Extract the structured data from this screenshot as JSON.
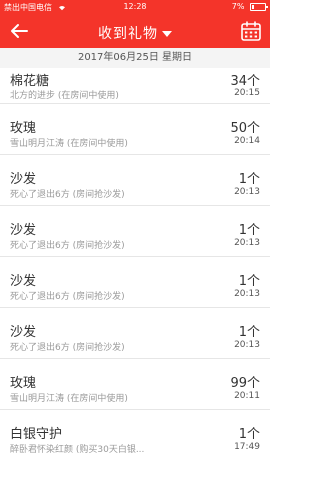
{
  "status_bar": {
    "carrier": "禁出中国电信",
    "time": "12:28",
    "battery": "7%"
  },
  "nav": {
    "title": "收到礼物",
    "back_icon": "back-arrow-icon",
    "calendar_icon": "calendar-icon"
  },
  "date_header": "2017年06月25日 星期日",
  "colors": {
    "accent": "#f4342a"
  },
  "gifts": [
    {
      "name": "棉花糖",
      "sub": "北方的进步 (在房间中使用)",
      "count": "34个",
      "time": "20:15"
    },
    {
      "name": "玫瑰",
      "sub": "雪山明月江涛 (在房间中使用)",
      "count": "50个",
      "time": "20:14"
    },
    {
      "name": "沙发",
      "sub": "死心了退出6方 (房间抢沙发)",
      "count": "1个",
      "time": "20:13"
    },
    {
      "name": "沙发",
      "sub": "死心了退出6方 (房间抢沙发)",
      "count": "1个",
      "time": "20:13"
    },
    {
      "name": "沙发",
      "sub": "死心了退出6方 (房间抢沙发)",
      "count": "1个",
      "time": "20:13"
    },
    {
      "name": "沙发",
      "sub": "死心了退出6方 (房间抢沙发)",
      "count": "1个",
      "time": "20:13"
    },
    {
      "name": "玫瑰",
      "sub": "雪山明月江涛 (在房间中使用)",
      "count": "99个",
      "time": "20:11"
    },
    {
      "name": "白银守护",
      "sub": "醉卧君怀染红颜 (购买30天白银...",
      "count": "1个",
      "time": "17:49"
    }
  ]
}
